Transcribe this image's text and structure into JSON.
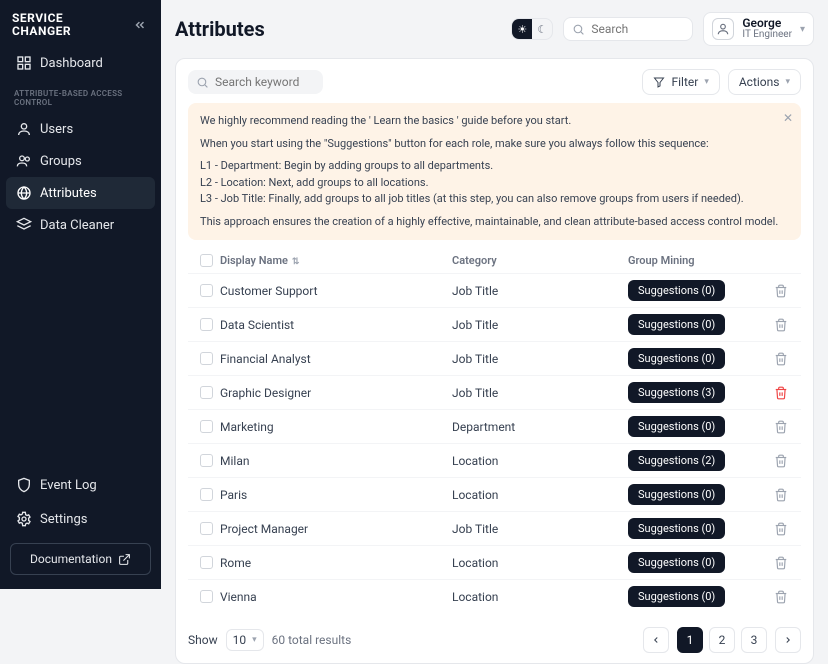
{
  "brand": {
    "line1": "SERVICE",
    "line2": "CHANGER"
  },
  "sidebar": {
    "dashboard": "Dashboard",
    "section": "ATTRIBUTE-BASED ACCESS CONTROL",
    "users": "Users",
    "groups": "Groups",
    "attributes": "Attributes",
    "dataCleaner": "Data Cleaner",
    "eventLog": "Event Log",
    "settings": "Settings",
    "documentation": "Documentation"
  },
  "header": {
    "title": "Attributes",
    "searchPlaceholder": "Search",
    "user": {
      "name": "George",
      "role": "IT Engineer"
    }
  },
  "toolbar": {
    "keywordPlaceholder": "Search keyword",
    "filter": "Filter",
    "actions": "Actions"
  },
  "notice": {
    "p1": "We highly recommend reading the ' Learn the basics ' guide before you start.",
    "p2": "When you start using the \"Suggestions\" button for each role, make sure you always follow this sequence:",
    "l1": "L1 - Department: Begin by adding groups to all departments.",
    "l2": "L2 - Location: Next, add groups to all locations.",
    "l3": "L3 - Job Title: Finally, add groups to all job titles (at this step, you can also remove groups from users if needed).",
    "p3": "This approach ensures the creation of a highly effective, maintainable, and clean attribute-based access control model."
  },
  "table": {
    "cols": {
      "name": "Display Name",
      "cat": "Category",
      "gm": "Group Mining"
    },
    "rows": [
      {
        "name": "Customer Support",
        "cat": "Job Title",
        "sug": "Suggestions (0)"
      },
      {
        "name": "Data Scientist",
        "cat": "Job Title",
        "sug": "Suggestions (0)"
      },
      {
        "name": "Financial Analyst",
        "cat": "Job Title",
        "sug": "Suggestions (0)"
      },
      {
        "name": "Graphic Designer",
        "cat": "Job Title",
        "sug": "Suggestions (3)",
        "red": true
      },
      {
        "name": "Marketing",
        "cat": "Department",
        "sug": "Suggestions (0)"
      },
      {
        "name": "Milan",
        "cat": "Location",
        "sug": "Suggestions (2)"
      },
      {
        "name": "Paris",
        "cat": "Location",
        "sug": "Suggestions (0)"
      },
      {
        "name": "Project Manager",
        "cat": "Job Title",
        "sug": "Suggestions (0)"
      },
      {
        "name": "Rome",
        "cat": "Location",
        "sug": "Suggestions (0)"
      },
      {
        "name": "Vienna",
        "cat": "Location",
        "sug": "Suggestions (0)"
      }
    ]
  },
  "footer": {
    "show": "Show",
    "size": "10",
    "total": "60 total results",
    "pages": [
      "1",
      "2",
      "3"
    ]
  }
}
